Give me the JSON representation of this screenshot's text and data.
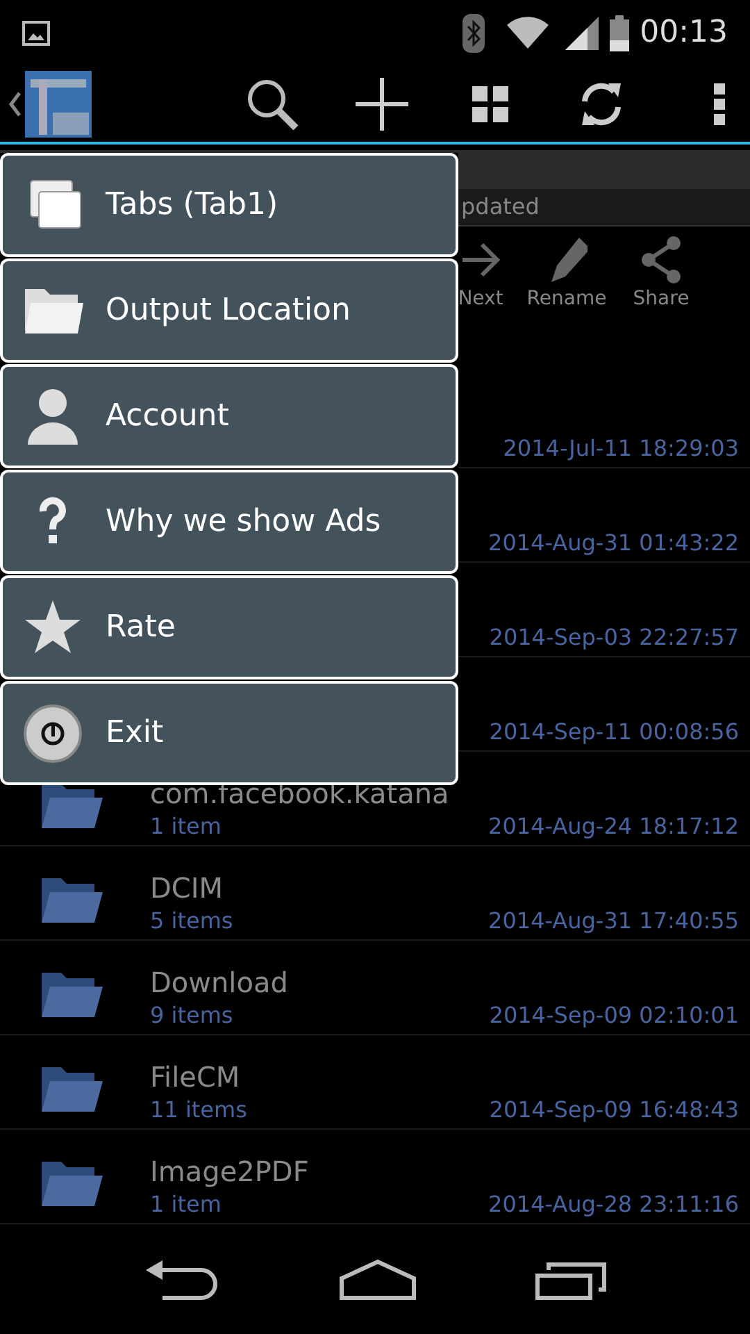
{
  "status_bar": {
    "time": "00:13"
  },
  "storage": {
    "status": "pdated"
  },
  "toolbar": [
    {
      "kind": "next",
      "label": "Next"
    },
    {
      "kind": "rename",
      "label": "Rename"
    },
    {
      "kind": "share",
      "label": "Share"
    }
  ],
  "files": [
    {
      "date": "2014-Jul-11 18:29:03"
    },
    {
      "date": "2014-Aug-31 01:43:22"
    },
    {
      "date": "2014-Sep-03 22:27:57"
    },
    {
      "date": "2014-Sep-11 00:08:56"
    },
    {
      "name": "com.facebook.katana",
      "count": "1 item",
      "date": "2014-Aug-24 18:17:12"
    },
    {
      "name": "DCIM",
      "count": "5 items",
      "date": "2014-Aug-31 17:40:55"
    },
    {
      "name": "Download",
      "count": "9 items",
      "date": "2014-Sep-09 02:10:01"
    },
    {
      "name": "FileCM",
      "count": "11 items",
      "date": "2014-Sep-09 16:48:43"
    },
    {
      "name": "Image2PDF",
      "count": "1 item",
      "date": "2014-Aug-28 23:11:16"
    }
  ],
  "menu": [
    {
      "kind": "tabs",
      "label": "Tabs (Tab1)"
    },
    {
      "kind": "folder",
      "label": "Output Location"
    },
    {
      "kind": "account",
      "label": "Account"
    },
    {
      "kind": "help",
      "label": "Why we show Ads"
    },
    {
      "kind": "rate",
      "label": "Rate"
    },
    {
      "kind": "exit",
      "label": "Exit"
    }
  ]
}
